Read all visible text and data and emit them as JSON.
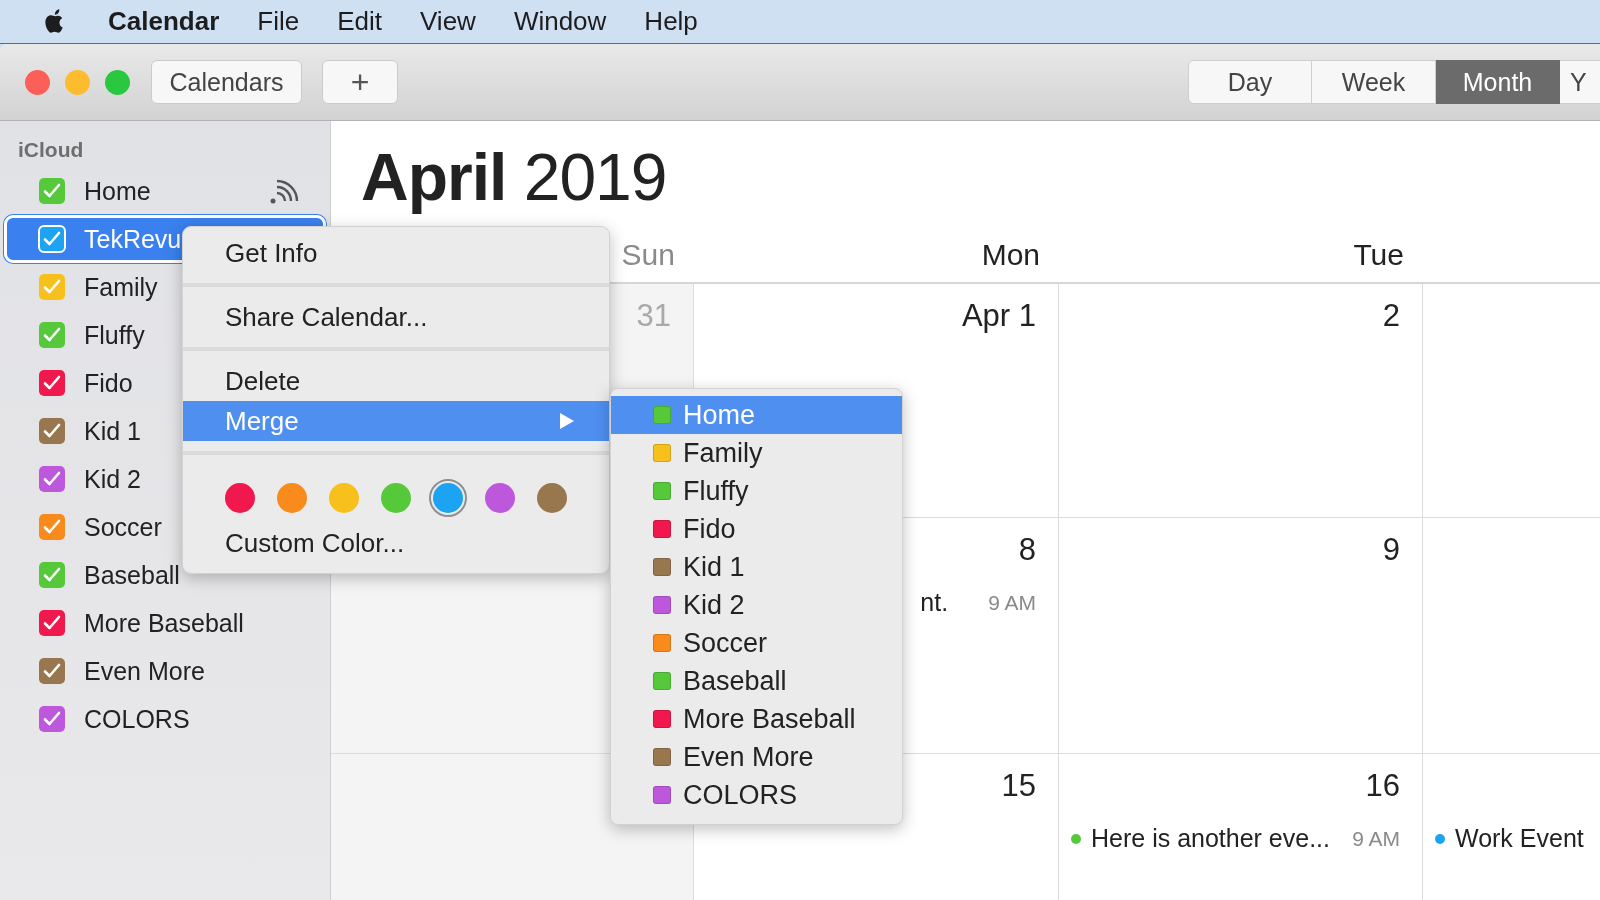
{
  "menu_bar": {
    "app": "Calendar",
    "menus": [
      "File",
      "Edit",
      "View",
      "Window",
      "Help"
    ]
  },
  "toolbar": {
    "buttons": [
      "Calendars",
      "+"
    ],
    "views": [
      {
        "label": "Day",
        "selected": false
      },
      {
        "label": "Week",
        "selected": false
      },
      {
        "label": "Month",
        "selected": true
      },
      {
        "label": "Y",
        "selected": false
      }
    ]
  },
  "sidebar": {
    "header": "iCloud",
    "items": [
      {
        "label": "Home",
        "checked": true,
        "selected": false,
        "color": "#55c93a",
        "shared": true
      },
      {
        "label": "TekRevu",
        "checked": true,
        "selected": true,
        "color": "#1ca4f2",
        "shared": false
      },
      {
        "label": "Family",
        "checked": true,
        "selected": false,
        "color": "#f8c01c",
        "shared": false
      },
      {
        "label": "Fluffy",
        "checked": true,
        "selected": false,
        "color": "#55c93a",
        "shared": false
      },
      {
        "label": "Fido",
        "checked": true,
        "selected": false,
        "color": "#f0184c",
        "shared": false
      },
      {
        "label": "Kid 1",
        "checked": true,
        "selected": false,
        "color": "#98774f",
        "shared": false
      },
      {
        "label": "Kid 2",
        "checked": true,
        "selected": false,
        "color": "#bd58dc",
        "shared": false
      },
      {
        "label": "Soccer",
        "checked": true,
        "selected": false,
        "color": "#f98a1c",
        "shared": false
      },
      {
        "label": "Baseball",
        "checked": true,
        "selected": false,
        "color": "#55c93a",
        "shared": false
      },
      {
        "label": "More Baseball",
        "checked": true,
        "selected": false,
        "color": "#f0184c",
        "shared": false
      },
      {
        "label": "Even More",
        "checked": true,
        "selected": false,
        "color": "#98774f",
        "shared": false
      },
      {
        "label": "COLORS",
        "checked": true,
        "selected": false,
        "color": "#bd58dc",
        "shared": false
      }
    ]
  },
  "calendar": {
    "month": "April",
    "year": "2019",
    "columns": [
      {
        "label": "Sun",
        "weekend": true
      },
      {
        "label": "Mon",
        "weekend": false
      },
      {
        "label": "Tue",
        "weekend": false
      }
    ],
    "rows": [
      {
        "cells": [
          {
            "date": "31",
            "dimmed": true
          },
          {
            "date": "Apr 1",
            "dimmed": false
          },
          {
            "date": "2",
            "dimmed": false
          }
        ]
      },
      {
        "cells": [
          "",
          {
            "date": "8",
            "dimmed": false,
            "events": [
              {
                "title": "nt.",
                "time": "9 AM"
              }
            ]
          },
          {
            "date": "9",
            "dimmed": false
          }
        ]
      },
      {
        "cells": [
          "",
          {
            "date": "15",
            "dimmed": false
          },
          {
            "date": "16",
            "dimmed": false,
            "events": [
              {
                "title": "Here is another eve...",
                "time": "9 AM",
                "color": "#55c93a"
              }
            ]
          },
          {
            "events": [
              {
                "title": "Work Event",
                "color": "#1ca4f2"
              }
            ]
          }
        ]
      }
    ]
  },
  "context_menu": {
    "items": [
      {
        "kind": "item",
        "label": "Get Info",
        "selected": false,
        "submenu": false
      },
      {
        "kind": "separator"
      },
      {
        "kind": "item",
        "label": "Share Calendar...",
        "selected": false,
        "submenu": false
      },
      {
        "kind": "separator"
      },
      {
        "kind": "item",
        "label": "Delete",
        "selected": false,
        "submenu": false
      },
      {
        "kind": "item",
        "label": "Merge",
        "selected": true,
        "submenu": true
      },
      {
        "kind": "separator"
      },
      {
        "kind": "colors",
        "colors": [
          {
            "color": "#f0184c",
            "selected": false
          },
          {
            "color": "#f98a1c",
            "selected": false
          },
          {
            "color": "#f8c01c",
            "selected": false
          },
          {
            "color": "#55c93a",
            "selected": false
          },
          {
            "color": "#1ca4f2",
            "selected": true
          },
          {
            "color": "#bd58dc",
            "selected": false
          },
          {
            "color": "#98774f",
            "selected": false
          }
        ]
      },
      {
        "kind": "item",
        "label": "Custom Color...",
        "selected": false,
        "submenu": false
      }
    ]
  },
  "submenu": {
    "items": [
      {
        "label": "Home",
        "color": "#55c93a",
        "selected": true
      },
      {
        "label": "Family",
        "color": "#f8c01c",
        "selected": false
      },
      {
        "label": "Fluffy",
        "color": "#55c93a",
        "selected": false
      },
      {
        "label": "Fido",
        "color": "#f0184c",
        "selected": false
      },
      {
        "label": "Kid 1",
        "color": "#98774f",
        "selected": false
      },
      {
        "label": "Kid 2",
        "color": "#bd58dc",
        "selected": false
      },
      {
        "label": "Soccer",
        "color": "#f98a1c",
        "selected": false
      },
      {
        "label": "Baseball",
        "color": "#55c93a",
        "selected": false
      },
      {
        "label": "More Baseball",
        "color": "#f0184c",
        "selected": false
      },
      {
        "label": "Even More",
        "color": "#98774f",
        "selected": false
      },
      {
        "label": "COLORS",
        "color": "#bd58dc",
        "selected": false
      }
    ]
  }
}
